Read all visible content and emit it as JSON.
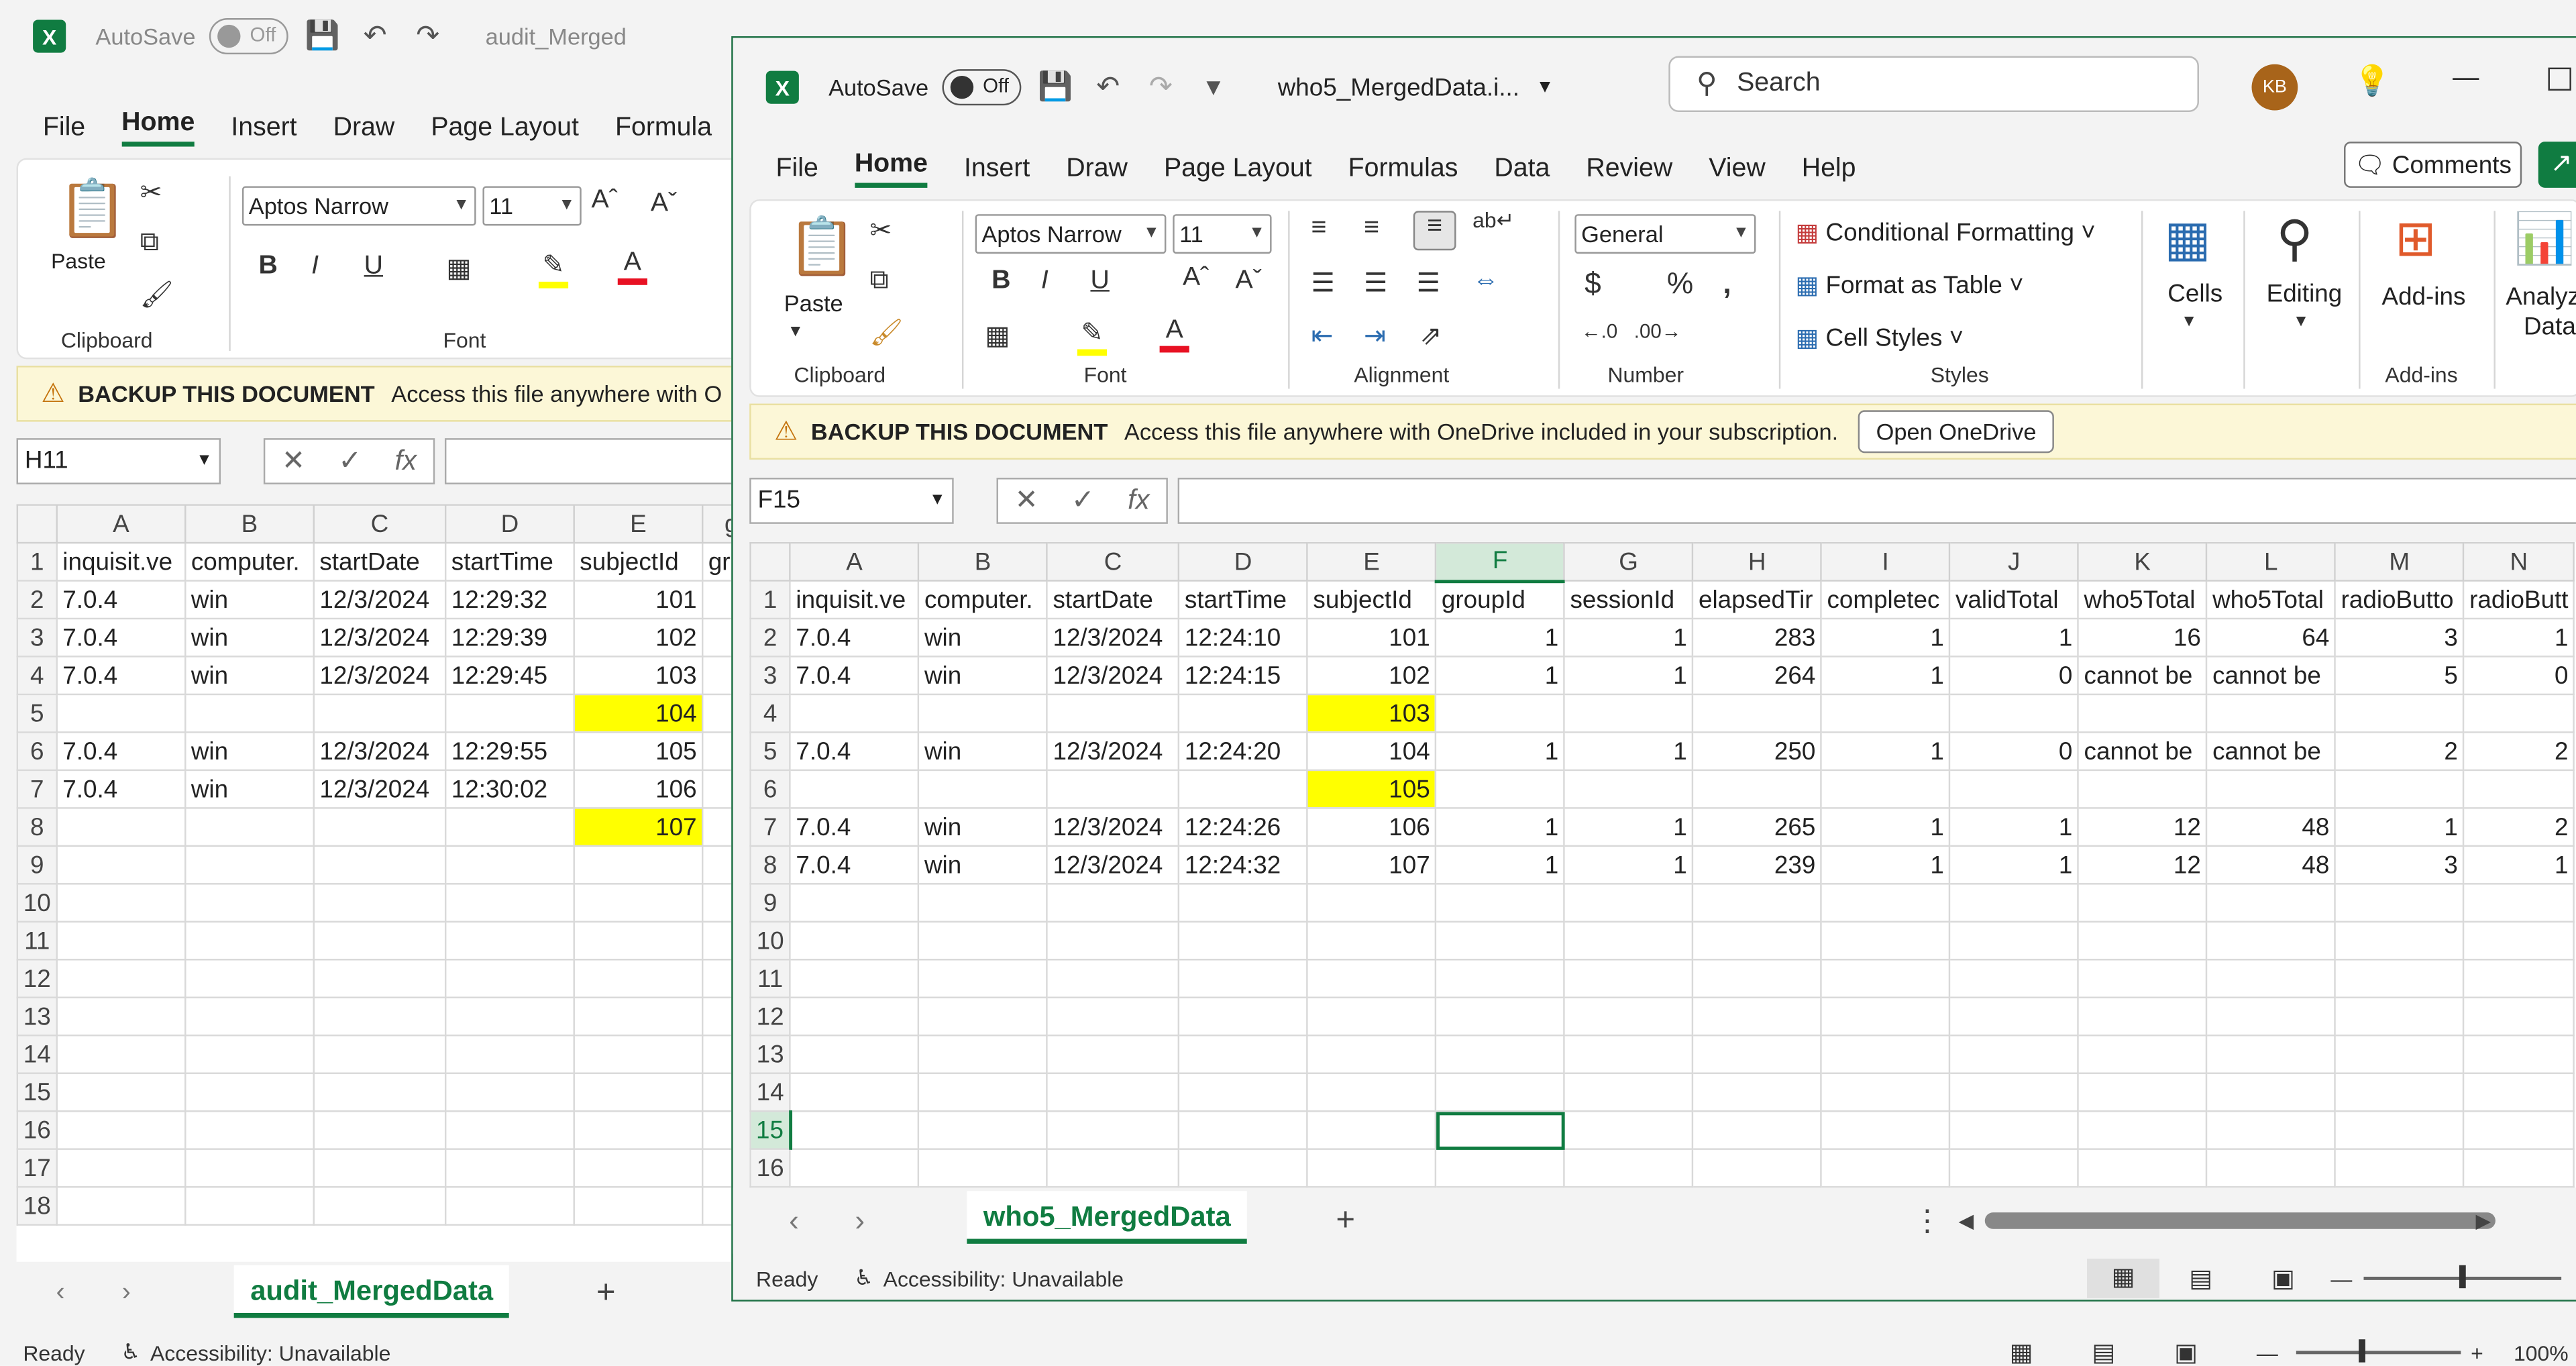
{
  "back": {
    "autosave_label": "AutoSave",
    "autosave_state": "Off",
    "file_title": "audit_Merged",
    "menu": [
      "File",
      "Home",
      "Insert",
      "Draw",
      "Page Layout",
      "Formula"
    ],
    "font_name": "Aptos Narrow",
    "font_size": "11",
    "clipboard_label": "Clipboard",
    "paste_label": "Paste",
    "font_label": "Font",
    "banner_title": "BACKUP THIS DOCUMENT",
    "banner_text": "Access this file anywhere with O",
    "name_box": "H11",
    "col_headers": [
      "A",
      "B",
      "C",
      "D",
      "E",
      "gr"
    ],
    "rows": [
      [
        "1",
        "inquisit.ve",
        "computer.",
        "startDate",
        "startTime",
        "subjectId",
        "gr"
      ],
      [
        "2",
        "7.0.4",
        "win",
        "12/3/2024",
        "12:29:32",
        "101",
        ""
      ],
      [
        "3",
        "7.0.4",
        "win",
        "12/3/2024",
        "12:29:39",
        "102",
        ""
      ],
      [
        "4",
        "7.0.4",
        "win",
        "12/3/2024",
        "12:29:45",
        "103",
        ""
      ],
      [
        "5",
        "",
        "",
        "",
        "",
        "104",
        ""
      ],
      [
        "6",
        "7.0.4",
        "win",
        "12/3/2024",
        "12:29:55",
        "105",
        ""
      ],
      [
        "7",
        "7.0.4",
        "win",
        "12/3/2024",
        "12:30:02",
        "106",
        ""
      ],
      [
        "8",
        "",
        "",
        "",
        "",
        "107",
        ""
      ],
      [
        "9",
        "",
        "",
        "",
        "",
        "",
        ""
      ],
      [
        "10",
        "",
        "",
        "",
        "",
        "",
        ""
      ],
      [
        "11",
        "",
        "",
        "",
        "",
        "",
        ""
      ],
      [
        "12",
        "",
        "",
        "",
        "",
        "",
        ""
      ],
      [
        "13",
        "",
        "",
        "",
        "",
        "",
        ""
      ],
      [
        "14",
        "",
        "",
        "",
        "",
        "",
        ""
      ],
      [
        "15",
        "",
        "",
        "",
        "",
        "",
        ""
      ],
      [
        "16",
        "",
        "",
        "",
        "",
        "",
        ""
      ],
      [
        "17",
        "",
        "",
        "",
        "",
        "",
        ""
      ],
      [
        "18",
        "",
        "",
        "",
        "",
        "",
        ""
      ]
    ],
    "sheet_tab": "audit_MergedData",
    "status_ready": "Ready",
    "status_accessibility": "Accessibility: Unavailable",
    "zoom": "100%"
  },
  "front": {
    "autosave_label": "AutoSave",
    "autosave_state": "Off",
    "file_title": "who5_MergedData.i...",
    "search_placeholder": "Search",
    "avatar_initials": "KB",
    "menu": [
      "File",
      "Home",
      "Insert",
      "Draw",
      "Page Layout",
      "Formulas",
      "Data",
      "Review",
      "View",
      "Help"
    ],
    "comments_label": "Comments",
    "paste_label": "Paste",
    "font_name": "Aptos Narrow",
    "font_size": "11",
    "number_format": "General",
    "conditional_formatting": "Conditional Formatting",
    "format_as_table": "Format as Table",
    "cell_styles": "Cell Styles",
    "cells_label": "Cells",
    "editing_label": "Editing",
    "addins_label": "Add-ins",
    "analyze_label": "Analyze Data",
    "group_labels": [
      "Clipboard",
      "Font",
      "Alignment",
      "Number",
      "Styles",
      "Add-ins"
    ],
    "banner_title": "BACKUP THIS DOCUMENT",
    "banner_text": "Access this file anywhere with OneDrive included in your subscription.",
    "banner_button": "Open OneDrive",
    "name_box": "F15",
    "col_headers": [
      "A",
      "B",
      "C",
      "D",
      "E",
      "F",
      "G",
      "H",
      "I",
      "J",
      "K",
      "L",
      "M",
      "N"
    ],
    "rows": [
      [
        "1",
        "inquisit.ve",
        "computer.",
        "startDate",
        "startTime",
        "subjectId",
        "groupId",
        "sessionId",
        "elapsedTir",
        "completec",
        "validTotal",
        "who5Total",
        "who5Total",
        "radioButto",
        "radioButt"
      ],
      [
        "2",
        "7.0.4",
        "win",
        "12/3/2024",
        "12:24:10",
        "101",
        "1",
        "1",
        "283",
        "1",
        "1",
        "16",
        "64",
        "3",
        "1"
      ],
      [
        "3",
        "7.0.4",
        "win",
        "12/3/2024",
        "12:24:15",
        "102",
        "1",
        "1",
        "264",
        "1",
        "0",
        "cannot be",
        "cannot be",
        "5",
        "0"
      ],
      [
        "4",
        "",
        "",
        "",
        "",
        "103",
        "",
        "",
        "",
        "",
        "",
        "",
        "",
        "",
        ""
      ],
      [
        "5",
        "7.0.4",
        "win",
        "12/3/2024",
        "12:24:20",
        "104",
        "1",
        "1",
        "250",
        "1",
        "0",
        "cannot be",
        "cannot be",
        "2",
        "2"
      ],
      [
        "6",
        "",
        "",
        "",
        "",
        "105",
        "",
        "",
        "",
        "",
        "",
        "",
        "",
        "",
        ""
      ],
      [
        "7",
        "7.0.4",
        "win",
        "12/3/2024",
        "12:24:26",
        "106",
        "1",
        "1",
        "265",
        "1",
        "1",
        "12",
        "48",
        "1",
        "2"
      ],
      [
        "8",
        "7.0.4",
        "win",
        "12/3/2024",
        "12:24:32",
        "107",
        "1",
        "1",
        "239",
        "1",
        "1",
        "12",
        "48",
        "3",
        "1"
      ],
      [
        "9",
        "",
        "",
        "",
        "",
        "",
        "",
        "",
        "",
        "",
        "",
        "",
        "",
        "",
        ""
      ],
      [
        "10",
        "",
        "",
        "",
        "",
        "",
        "",
        "",
        "",
        "",
        "",
        "",
        "",
        "",
        ""
      ],
      [
        "11",
        "",
        "",
        "",
        "",
        "",
        "",
        "",
        "",
        "",
        "",
        "",
        "",
        "",
        ""
      ],
      [
        "12",
        "",
        "",
        "",
        "",
        "",
        "",
        "",
        "",
        "",
        "",
        "",
        "",
        "",
        ""
      ],
      [
        "13",
        "",
        "",
        "",
        "",
        "",
        "",
        "",
        "",
        "",
        "",
        "",
        "",
        "",
        ""
      ],
      [
        "14",
        "",
        "",
        "",
        "",
        "",
        "",
        "",
        "",
        "",
        "",
        "",
        "",
        "",
        ""
      ],
      [
        "15",
        "",
        "",
        "",
        "",
        "",
        "",
        "",
        "",
        "",
        "",
        "",
        "",
        "",
        ""
      ],
      [
        "16",
        "",
        "",
        "",
        "",
        "",
        "",
        "",
        "",
        "",
        "",
        "",
        "",
        "",
        ""
      ]
    ],
    "sheet_tab": "who5_MergedData",
    "status_ready": "Ready",
    "status_accessibility": "Accessibility: Unavailable",
    "colors": {
      "excel_green": "#107c41",
      "highlight_yellow": "#ffff00",
      "font_red": "#e81123"
    }
  }
}
